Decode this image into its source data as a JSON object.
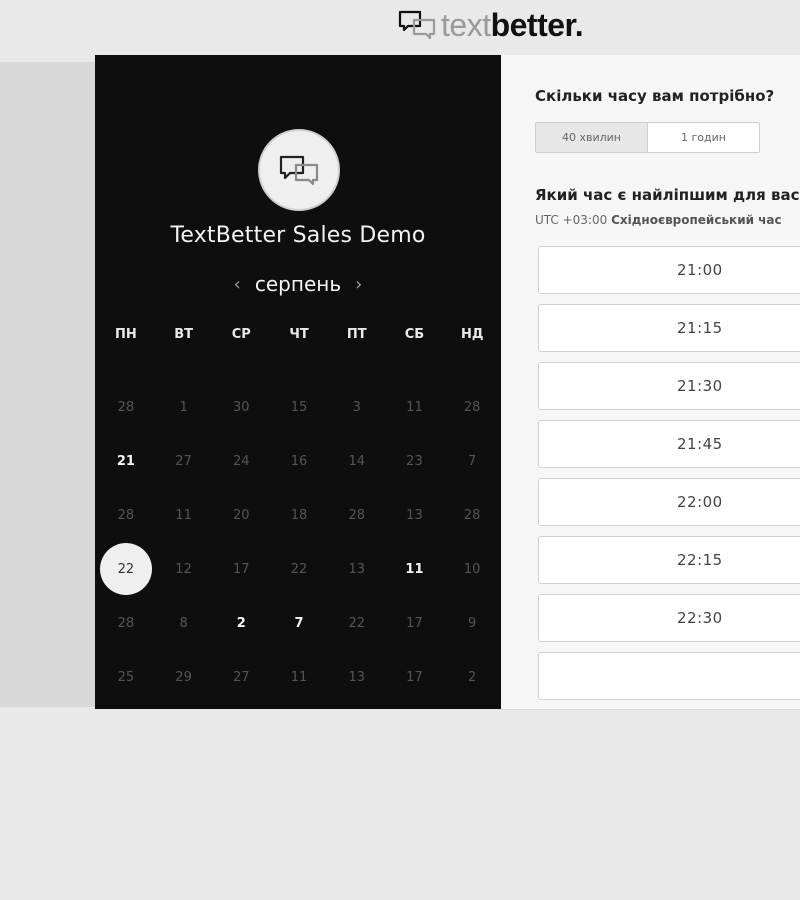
{
  "brand": {
    "text_light": "text",
    "text_bold": "better",
    "dot": "."
  },
  "calendar": {
    "title": "TextBetter Sales Demo",
    "month": "серпень",
    "prev_icon": "‹",
    "next_icon": "›",
    "weekdays": [
      "ПН",
      "ВТ",
      "СР",
      "ЧТ",
      "ПТ",
      "СБ",
      "НД"
    ],
    "weeks": [
      [
        "28",
        "1",
        "30",
        "15",
        "3",
        "11",
        "28"
      ],
      [
        "21",
        "27",
        "24",
        "16",
        "14",
        "23",
        "7"
      ],
      [
        "28",
        "11",
        "20",
        "18",
        "28",
        "13",
        "28"
      ],
      [
        "22",
        "12",
        "17",
        "22",
        "13",
        "11",
        "10"
      ],
      [
        "28",
        "8",
        "2",
        "7",
        "22",
        "17",
        "9"
      ],
      [
        "25",
        "29",
        "27",
        "11",
        "13",
        "17",
        "2"
      ]
    ],
    "active_cells": [
      "1-0",
      "3-5",
      "4-2",
      "4-3"
    ],
    "selected_cell": "3-0"
  },
  "booking": {
    "duration_question": "Скільки часу вам потрібно?",
    "duration_options": [
      "40 хвилин",
      "1 годин"
    ],
    "time_question": "Який час є найліпшим для вас?",
    "tz_offset": "UTC +03:00",
    "tz_name": "Східноєвропейський час",
    "slots": [
      "21:00",
      "21:15",
      "21:30",
      "21:45",
      "22:00",
      "22:15",
      "22:30"
    ]
  }
}
